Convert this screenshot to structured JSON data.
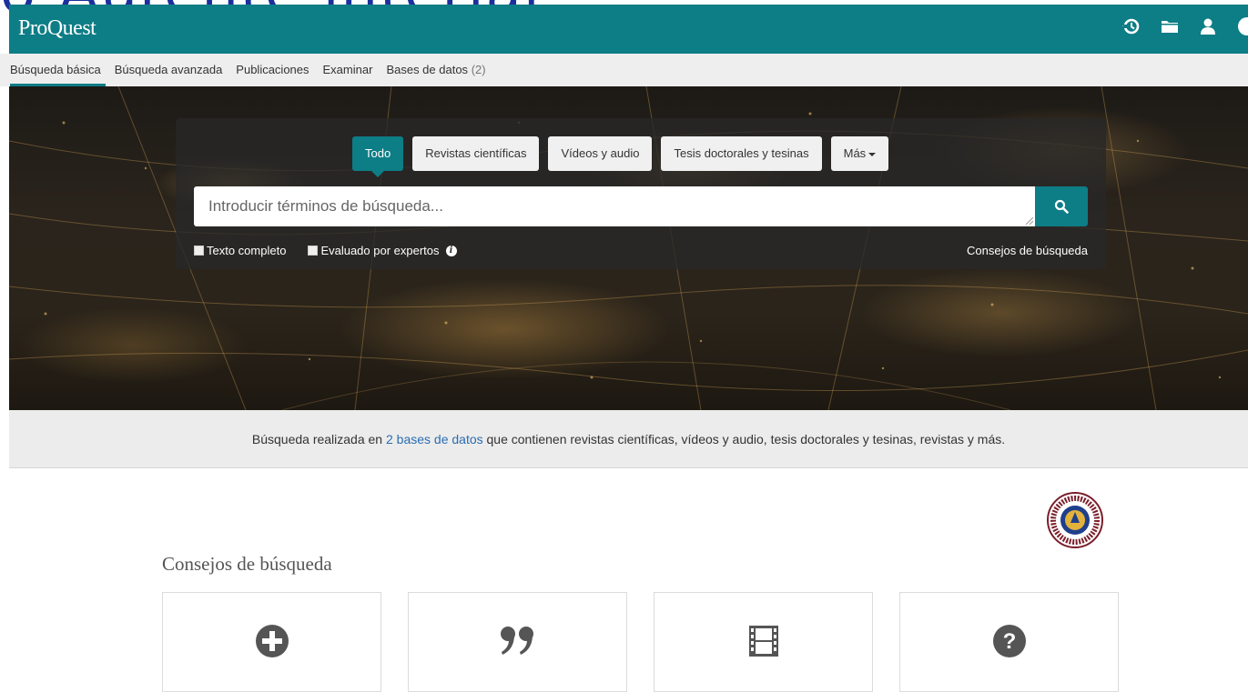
{
  "overlay": {
    "clipped_text": "o:Aurente interial"
  },
  "header": {
    "logo": "ProQuest",
    "icons": [
      "history-icon",
      "folder-icon",
      "user-icon",
      "help-icon"
    ]
  },
  "nav": {
    "items": [
      {
        "label": "Búsqueda básica",
        "active": true
      },
      {
        "label": "Búsqueda avanzada"
      },
      {
        "label": "Publicaciones"
      },
      {
        "label": "Examinar"
      },
      {
        "label": "Bases de datos",
        "count": "(2)"
      }
    ]
  },
  "search": {
    "tabs": [
      "Todo",
      "Revistas científicas",
      "Vídeos y audio",
      "Tesis doctorales y tesinas",
      "Más"
    ],
    "active_tab": "Todo",
    "placeholder": "Introducir términos de búsqueda...",
    "value": "",
    "options": {
      "full_text": "Texto completo",
      "peer_reviewed": "Evaluado por expertos"
    },
    "tips_link": "Consejos de búsqueda"
  },
  "databases": {
    "prefix": "Búsqueda realizada en ",
    "link": "2 bases de datos",
    "suffix": " que contienen revistas científicas, vídeos y audio, tesis doctorales y tesinas, revistas y más."
  },
  "tips": {
    "heading": "Consejos de búsqueda",
    "cards": [
      {
        "icon": "plus-circle-icon"
      },
      {
        "icon": "quote-icon"
      },
      {
        "icon": "film-icon"
      },
      {
        "icon": "question-circle-icon"
      }
    ]
  },
  "colors": {
    "brand": "#0d7d86",
    "link": "#2a6db0"
  }
}
